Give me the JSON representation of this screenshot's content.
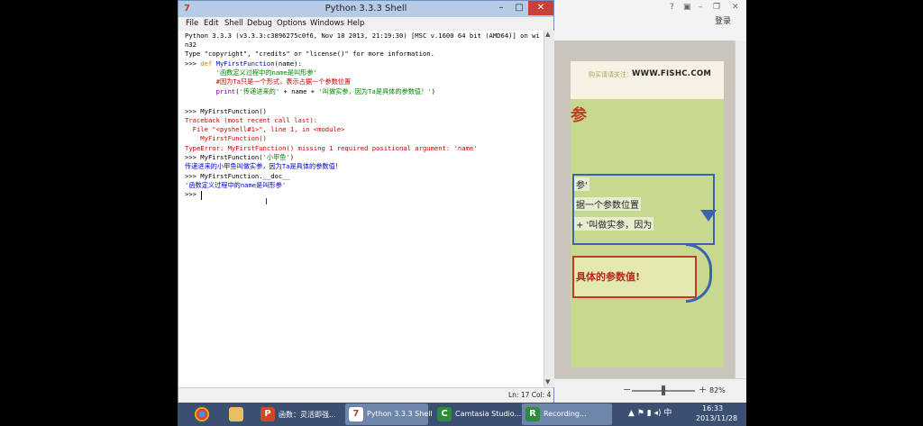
{
  "shell": {
    "title": "Python 3.3.3 Shell",
    "menu": [
      "File",
      "Edit",
      "Shell",
      "Debug",
      "Options",
      "Windows",
      "Help"
    ],
    "lines": {
      "l1": "Python 3.3.3 (v3.3.3:c3896275c0f6, Nov 18 2013, 21:19:30) [MSC v.1600 64 bit (AMD64)] on wi",
      "l2": "n32",
      "l3": "Type \"copyright\", \"credits\" or \"license()\" for more information.",
      "l4_prompt": ">>> ",
      "l4_def": "def",
      "l4_name": " MyFirstFunction",
      "l4_rest": "(name):",
      "l5": "        '函数定义过程中的name是叫形参'",
      "l6": "        #因为Ta只是一个形式，表示占据一个参数位置",
      "l7_print": "        print",
      "l7_a": "(",
      "l7_s1": "'传递进来的'",
      "l7_b": " + name + ",
      "l7_s2": "'叫做实参，因为Ta是具体的参数值！'",
      "l7_c": ")",
      "l9": ">>> MyFirstFunction()",
      "l10": "Traceback (most recent call last):",
      "l11": "  File \"<pyshell#1>\", line 1, in <module>",
      "l12": "    MyFirstFunction()",
      "l13": "TypeError: MyFirstFunction() missing 1 required positional argument: 'name'",
      "l14_a": ">>> MyFirstFunction(",
      "l14_s": "'小甲鱼'",
      "l14_b": ")",
      "l15": "传递进来的小甲鱼叫做实参，因为Ta是具体的参数值！",
      "l16": ">>> MyFirstFunction.__doc__",
      "l17": "'函数定义过程中的name是叫形参'",
      "l18": ">>> "
    },
    "status": "Ln: 17 Col: 4",
    "colors": {
      "keyword": "#e67800",
      "string": "#008800",
      "output": "#0000cc",
      "error": "#cc0000",
      "builtin": "#7b00a0"
    }
  },
  "ppt": {
    "login": "登录",
    "slide_hint": "购买请请关注：",
    "slide_url": "WWW.FISHC.COM",
    "slide_mark": "参",
    "code1": "参'",
    "code2": "据一个参数位置",
    "code3": "+ '叫做实参，因为",
    "red_text": "具体的参数值!",
    "zoom": "82%",
    "zoom_minus": "−",
    "zoom_plus": "+"
  },
  "taskbar": {
    "items": [
      {
        "label": "函数：灵活即强...",
        "icon": "P"
      },
      {
        "label": "Python 3.3.3 Shell",
        "icon": "7"
      },
      {
        "label": "Camtasia Studio...",
        "icon": "C"
      },
      {
        "label": "Recording...",
        "icon": "R"
      }
    ],
    "time": "16:33",
    "date": "2013/11/28"
  }
}
